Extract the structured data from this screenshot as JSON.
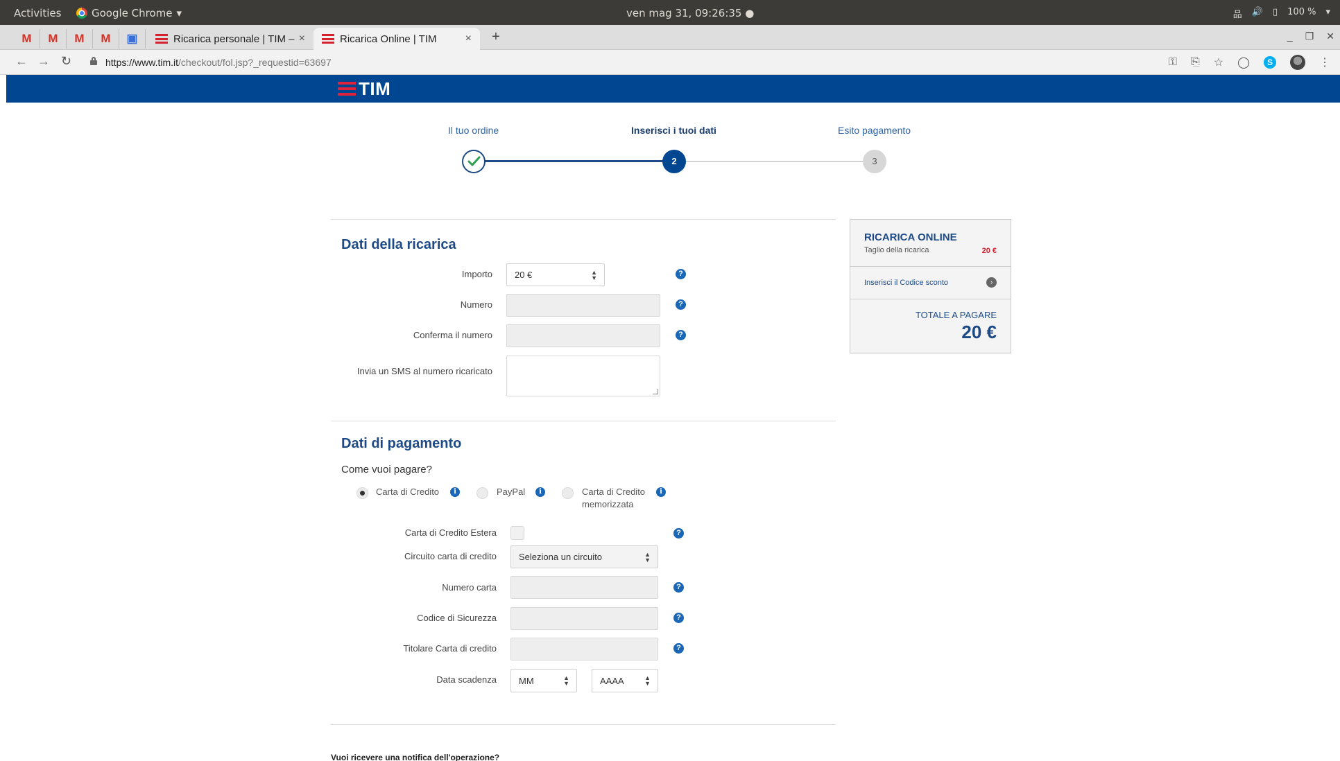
{
  "os": {
    "activities": "Activities",
    "app_name": "Google Chrome",
    "clock": "ven mag 31, 09:26:35 ●",
    "battery": "100 %"
  },
  "browser": {
    "tabs": [
      {
        "title": "Ricarica personale | TIM –",
        "close": "×"
      },
      {
        "title": "Ricarica Online | TIM",
        "close": "×"
      }
    ],
    "new_tab": "+",
    "url_host": "https://www.tim.it",
    "url_path": "/checkout/fol.jsp?_requestid=63697"
  },
  "brand": {
    "logo_text": "TIM",
    "primary": "#004691",
    "accent": "#e1223a"
  },
  "stepper": {
    "steps": [
      {
        "label": "Il tuo ordine",
        "marker": "✓"
      },
      {
        "label": "Inserisci i tuoi dati",
        "marker": "2"
      },
      {
        "label": "Esito pagamento",
        "marker": "3"
      }
    ],
    "current_step": 2
  },
  "ricarica": {
    "title": "Dati della ricarica",
    "importo_label": "Importo",
    "importo_value": "20 €",
    "numero_label": "Numero",
    "conferma_label": "Conferma il numero",
    "sms_label": "Invia un SMS al numero ricaricato"
  },
  "pagamento": {
    "title": "Dati di pagamento",
    "question": "Come vuoi pagare?",
    "methods": [
      {
        "label": "Carta di Credito",
        "checked": true
      },
      {
        "label": "PayPal",
        "checked": false
      },
      {
        "label": "Carta di Credito memorizzata",
        "line1": "Carta di Credito",
        "line2": "memorizzata",
        "checked": false
      }
    ],
    "estera_label": "Carta di Credito Estera",
    "circuito_label": "Circuito carta di credito",
    "circuito_value": "Seleziona un circuito",
    "numero_carta_label": "Numero carta",
    "codice_label": "Codice di Sicurezza",
    "titolare_label": "Titolare Carta di credito",
    "scadenza_label": "Data scadenza",
    "mese_value": "MM",
    "anno_value": "AAAA"
  },
  "notifica_question": "Vuoi ricevere una notifica dell'operazione?",
  "summary": {
    "heading": "RICARICA ONLINE",
    "taglio_label": "Taglio della ricarica",
    "taglio_value": "20 €",
    "codice_sconto": "Inserisci il Codice sconto",
    "totale_label": "TOTALE A PAGARE",
    "totale_value": "20 €"
  },
  "icons": {
    "help": "?",
    "info": "i",
    "arrow": "›"
  }
}
